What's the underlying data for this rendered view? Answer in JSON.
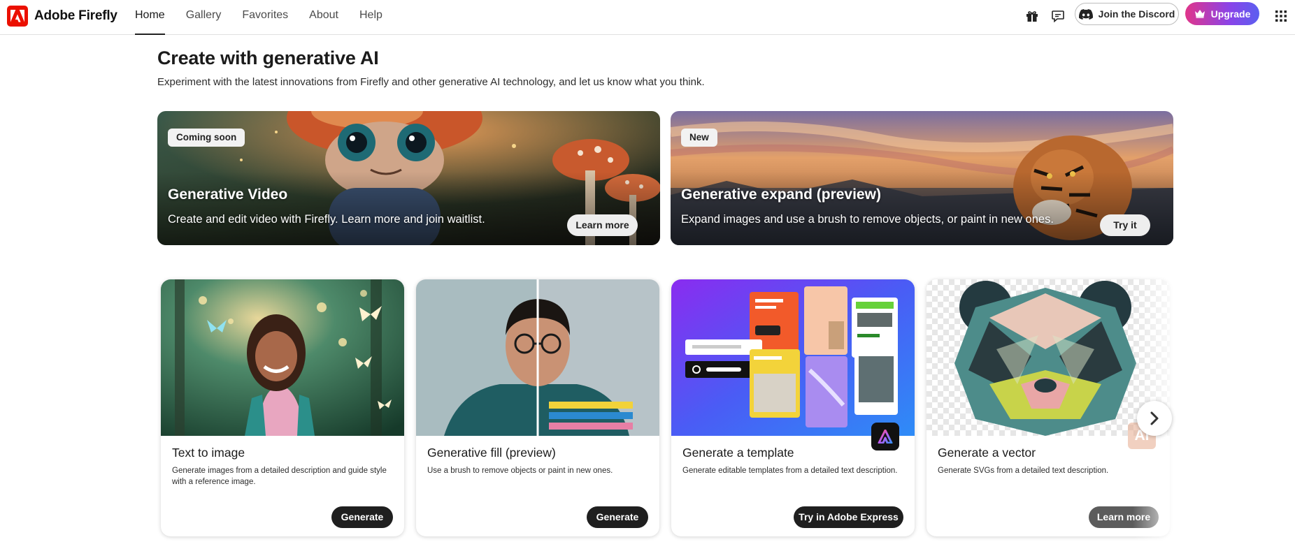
{
  "header": {
    "brand": "Adobe Firefly",
    "brand_logo_icon": "adobe-logo-icon",
    "nav": [
      {
        "label": "Home",
        "active": true
      },
      {
        "label": "Gallery",
        "active": false
      },
      {
        "label": "Favorites",
        "active": false
      },
      {
        "label": "About",
        "active": false
      },
      {
        "label": "Help",
        "active": false
      }
    ],
    "gift_icon": "gift-icon",
    "feedback_icon": "chat-bubble-icon",
    "discord_label": "Join the Discord",
    "discord_icon": "discord-icon",
    "upgrade_label": "Upgrade",
    "upgrade_icon": "crown-icon",
    "apps_icon": "app-grid-icon"
  },
  "main": {
    "title": "Create with generative AI",
    "subtitle": "Experiment with the latest innovations from Firefly and other generative AI technology, and let us know what you think."
  },
  "banners": [
    {
      "badge": "Coming soon",
      "title": "Generative Video",
      "description": "Create and edit video with Firefly. Learn more and join waitlist.",
      "button": "Learn more"
    },
    {
      "badge": "New",
      "title": "Generative expand (preview)",
      "description": "Expand images and use a brush to remove objects, or paint in new ones.",
      "button": "Try it"
    }
  ],
  "cards": [
    {
      "title": "Text to image",
      "description": "Generate images from a detailed description and guide style with a reference image.",
      "button": "Generate"
    },
    {
      "title": "Generative fill (preview)",
      "description": "Use a brush to remove objects or paint in new ones.",
      "button": "Generate"
    },
    {
      "title": "Generate a template",
      "description": "Generate editable templates from a detailed text description.",
      "button": "Try in Adobe Express"
    },
    {
      "title": "Generate a vector",
      "description": "Generate SVGs from a detailed text description.",
      "button": "Learn more"
    }
  ],
  "vector_card_badge": "Ai",
  "carousel_next_icon": "chevron-right-icon",
  "colors": {
    "adobe_red": "#eb1000",
    "upgrade_gradient_start": "#e0358a",
    "upgrade_gradient_end": "#5b5ff0",
    "primary_button": "#1f1f1f"
  }
}
